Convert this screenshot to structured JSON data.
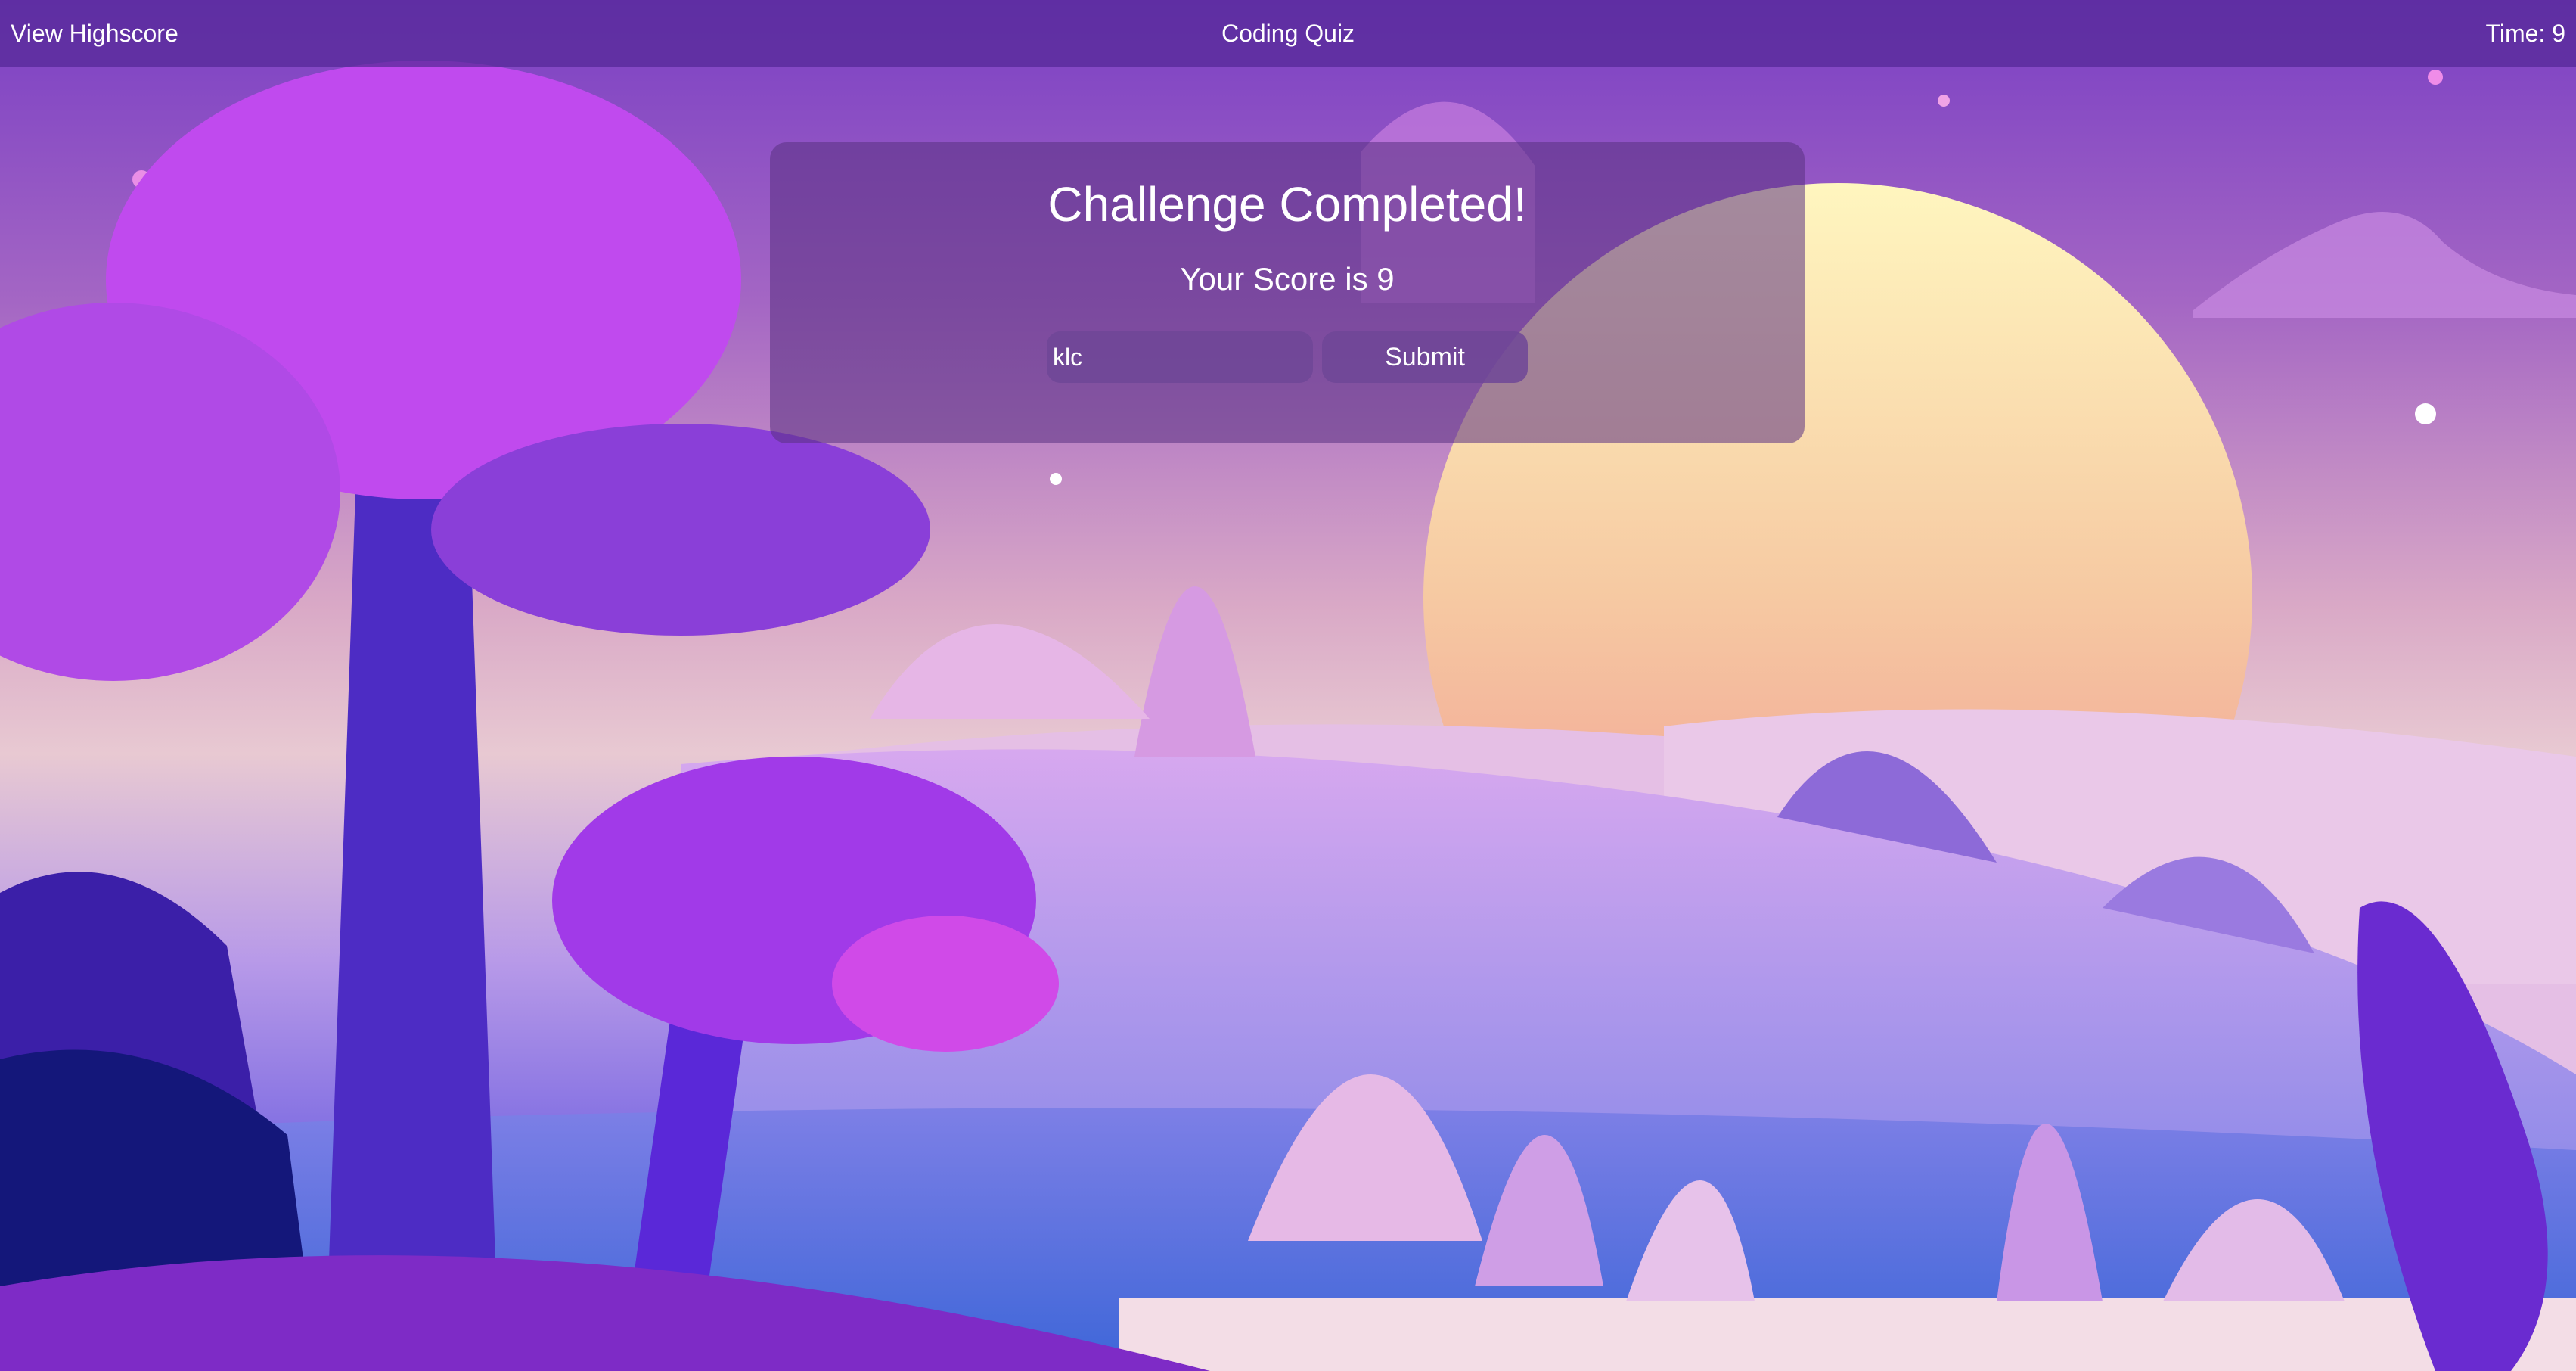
{
  "header": {
    "highscore_link": "View Highscore",
    "title": "Coding Quiz",
    "timer": "Time: 9"
  },
  "result": {
    "heading": "Challenge Completed!",
    "score_text": "Your Score is 9",
    "initials_value": "klc",
    "submit_label": "Submit"
  },
  "colors": {
    "header_bg": "#5a2a96",
    "card_bg": "#5a3282",
    "sun": "#f6d9a0"
  }
}
